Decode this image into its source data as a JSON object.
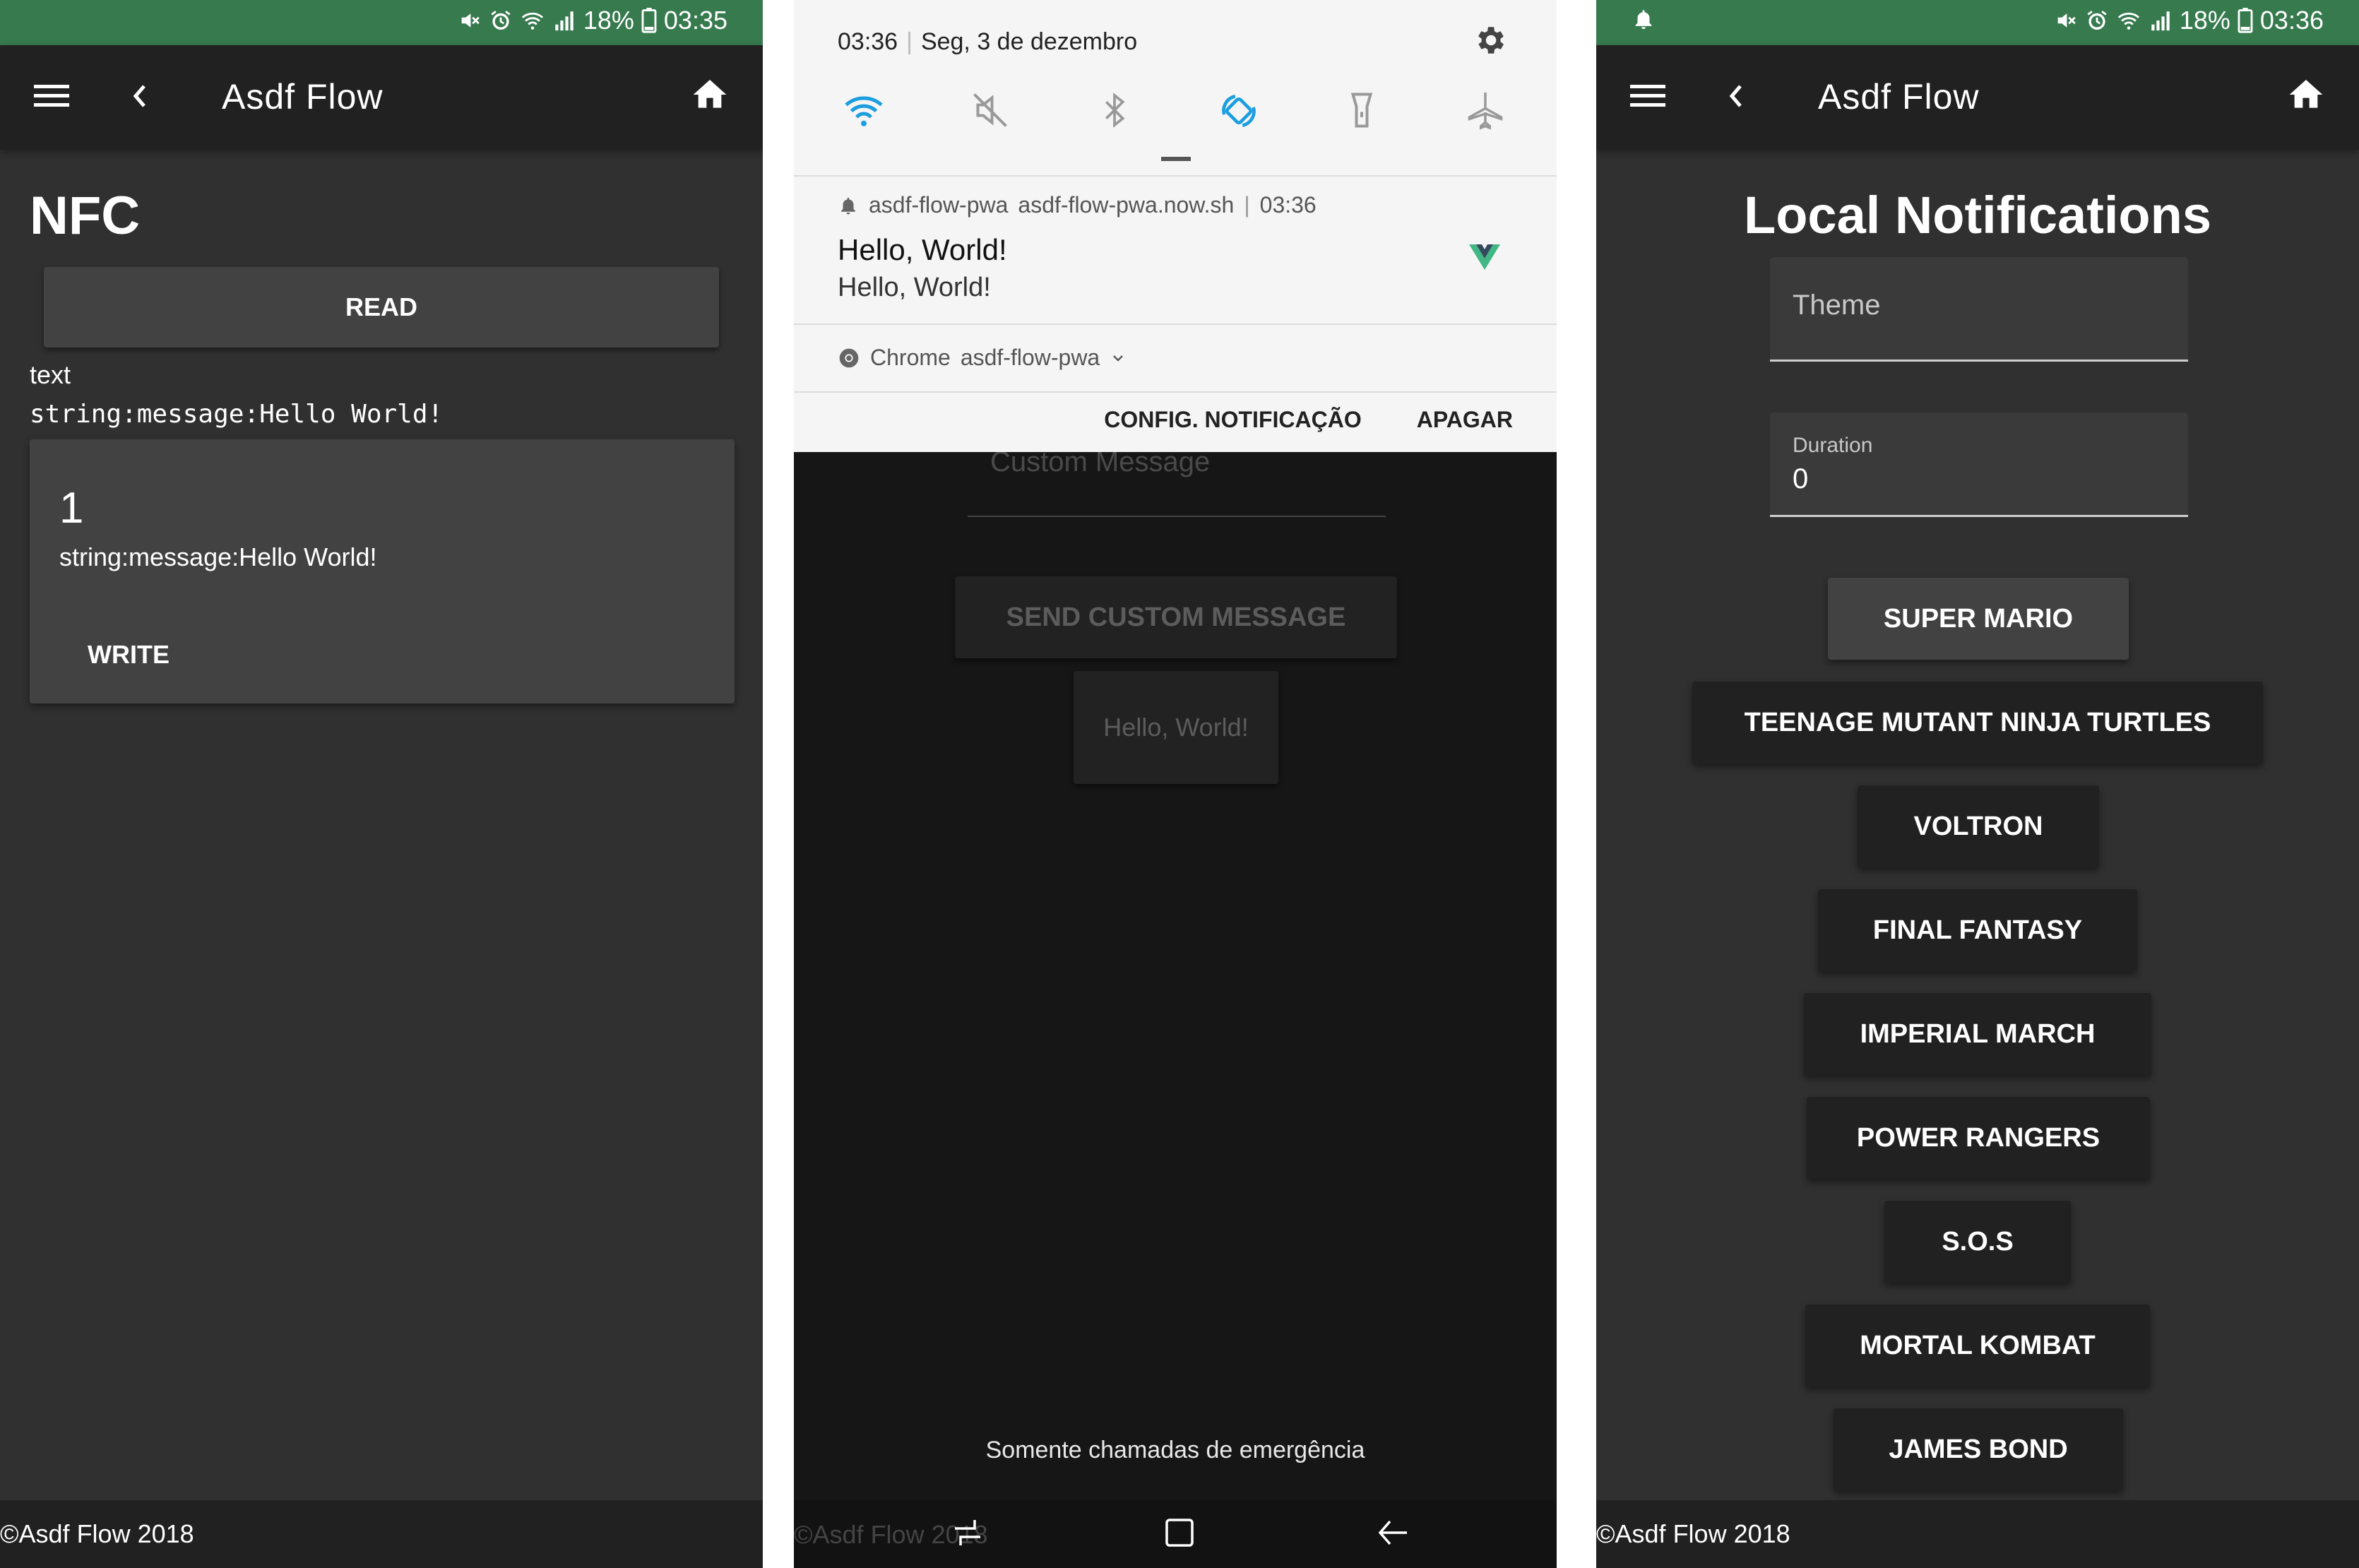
{
  "screen1": {
    "status": {
      "battery": "18%",
      "time": "03:35"
    },
    "app_title": "Asdf Flow",
    "page_title": "NFC",
    "read_button": "READ",
    "record_type": "text",
    "record_raw": "string:message:Hello World!",
    "card": {
      "index": "1",
      "message": "string:message:Hello World!",
      "write_button": "WRITE"
    },
    "footer": "©Asdf Flow 2018"
  },
  "screen2": {
    "shade": {
      "time": "03:36",
      "date": "Seg, 3 de dezembro"
    },
    "quick_settings": [
      "wifi-icon",
      "mute-icon",
      "bluetooth-icon",
      "auto-rotate-icon",
      "flashlight-icon",
      "airplane-icon"
    ],
    "notification": {
      "app": "asdf-flow-pwa",
      "host": "asdf-flow-pwa.now.sh",
      "time": "03:36",
      "title": "Hello, World!",
      "body": "Hello, World!",
      "source_app": "Chrome",
      "source_site": "asdf-flow-pwa",
      "action_settings": "CONFIG. NOTIFICAÇÃO",
      "action_clear": "APAGAR"
    },
    "behind": {
      "input_placeholder": "Custom Message",
      "send_button": "SEND CUSTOM MESSAGE",
      "message_button": "Hello, World!",
      "footer": "©Asdf Flow 2018"
    },
    "emergency_text": "Somente chamadas de emergência"
  },
  "screen3": {
    "status": {
      "battery": "18%",
      "time": "03:36"
    },
    "app_title": "Asdf Flow",
    "page_title": "Local Notifications",
    "theme_placeholder": "Theme",
    "duration_label": "Duration",
    "duration_value": "0",
    "buttons": [
      "SUPER MARIO",
      "TEENAGE MUTANT NINJA TURTLES",
      "VOLTRON",
      "FINAL FANTASY",
      "IMPERIAL MARCH",
      "POWER RANGERS",
      "S.O.S",
      "MORTAL KOMBAT",
      "JAMES BOND"
    ],
    "footer": "©Asdf Flow 2018"
  },
  "colors": {
    "status_bar": "#367a4e",
    "app_bar": "#212121",
    "background": "#303030",
    "card": "#424242",
    "notification_accent": "#1a9ee0",
    "vue_green": "#41b883"
  }
}
